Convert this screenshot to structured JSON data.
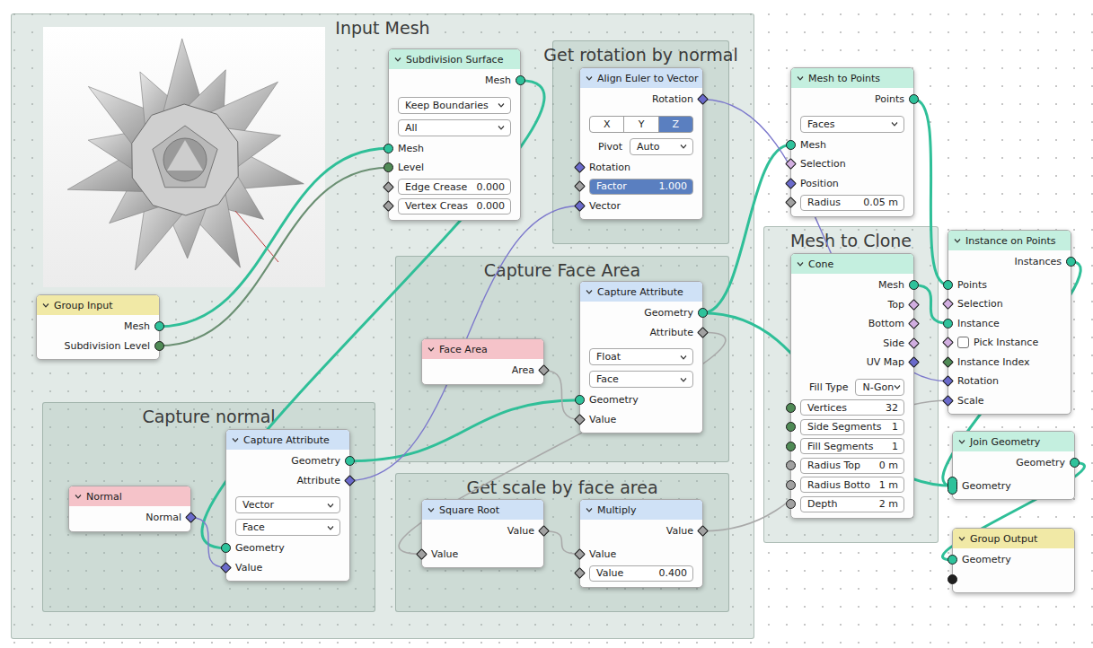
{
  "frames": [
    {
      "label": "Input Mesh"
    },
    {
      "label": "Get rotation by normal"
    },
    {
      "label": "Capture Face Area"
    },
    {
      "label": "Capture normal"
    },
    {
      "label": "Get scale by face area"
    },
    {
      "label": "Mesh to Clone"
    }
  ],
  "nodes": [
    {
      "title": "Group Input",
      "color": "#f1e9a6",
      "expanded": true,
      "rows": [
        {
          "kind": "output",
          "label": "Mesh",
          "socket": "geometry",
          "shape": "circle"
        },
        {
          "kind": "output",
          "label": "Subdivision Level",
          "socket": "int",
          "shape": "circle"
        }
      ]
    },
    {
      "title": "Subdivision Surface",
      "color": "#c4efdf",
      "expanded": true,
      "rows": [
        {
          "kind": "output",
          "label": "Mesh",
          "socket": "geometry",
          "shape": "circle"
        },
        {
          "kind": "dropdown",
          "value": "Keep Boundaries"
        },
        {
          "kind": "dropdown",
          "value": "All"
        },
        {
          "kind": "input",
          "label": "Mesh",
          "socket": "geometry",
          "shape": "circle"
        },
        {
          "kind": "input",
          "label": "Level",
          "socket": "int",
          "shape": "circle"
        },
        {
          "kind": "field",
          "label": "Edge Crease",
          "value": "0.000",
          "socket": "float",
          "shape": "diamond"
        },
        {
          "kind": "field",
          "label": "Vertex Creas",
          "value": "0.000",
          "socket": "float",
          "shape": "diamond"
        }
      ]
    },
    {
      "title": "Capture Attribute",
      "color": "#cfe1f6",
      "expanded": true,
      "rows": [
        {
          "kind": "output",
          "label": "Geometry",
          "socket": "geometry",
          "shape": "circle"
        },
        {
          "kind": "output",
          "label": "Attribute",
          "socket": "vector",
          "shape": "diamond"
        },
        {
          "kind": "dropdown",
          "value": "Vector"
        },
        {
          "kind": "dropdown",
          "value": "Face"
        },
        {
          "kind": "input",
          "label": "Geometry",
          "socket": "geometry",
          "shape": "circle"
        },
        {
          "kind": "input",
          "label": "Value",
          "socket": "vector",
          "shape": "diamond"
        }
      ]
    },
    {
      "title": "Normal",
      "color": "#f5c3c9",
      "expanded": true,
      "rows": [
        {
          "kind": "output",
          "label": "Normal",
          "socket": "vector",
          "shape": "diamond"
        }
      ]
    },
    {
      "title": "Align Euler to Vector",
      "color": "#cfe1f6",
      "expanded": true,
      "rows": [
        {
          "kind": "output",
          "label": "Rotation",
          "socket": "vector",
          "shape": "diamond"
        },
        {
          "kind": "buttons",
          "options": [
            {
              "label": "X",
              "selected": false
            },
            {
              "label": "Y",
              "selected": false
            },
            {
              "label": "Z",
              "selected": true
            }
          ]
        },
        {
          "kind": "labeled-dropdown",
          "label": "Pivot",
          "value": "Auto"
        },
        {
          "kind": "input",
          "label": "Rotation",
          "socket": "vector",
          "shape": "diamond"
        },
        {
          "kind": "slider",
          "label": "Factor",
          "value": "1.000",
          "level": 1,
          "socket": "float",
          "shape": "diamond"
        },
        {
          "kind": "input",
          "label": "Vector",
          "socket": "vector",
          "shape": "diamond"
        }
      ]
    },
    {
      "title": "Face Area",
      "color": "#f5c3c9",
      "expanded": true,
      "rows": [
        {
          "kind": "output",
          "label": "Area",
          "socket": "float",
          "shape": "diamond"
        }
      ]
    },
    {
      "title": "Capture Attribute",
      "color": "#cfe1f6",
      "expanded": true,
      "rows": [
        {
          "kind": "output",
          "label": "Geometry",
          "socket": "geometry",
          "shape": "circle"
        },
        {
          "kind": "output",
          "label": "Attribute",
          "socket": "float",
          "shape": "diamond"
        },
        {
          "kind": "dropdown",
          "value": "Float"
        },
        {
          "kind": "dropdown",
          "value": "Face"
        },
        {
          "kind": "input",
          "label": "Geometry",
          "socket": "geometry",
          "shape": "circle"
        },
        {
          "kind": "input",
          "label": "Value",
          "socket": "float",
          "shape": "diamond"
        }
      ]
    },
    {
      "title": "Square Root",
      "color": "#cfe1f6",
      "expanded": true,
      "rows": [
        {
          "kind": "output",
          "label": "Value",
          "socket": "float",
          "shape": "diamond"
        },
        {
          "kind": "input",
          "label": "Value",
          "socket": "float",
          "shape": "diamond"
        }
      ]
    },
    {
      "title": "Multiply",
      "color": "#cfe1f6",
      "expanded": true,
      "rows": [
        {
          "kind": "output",
          "label": "Value",
          "socket": "float",
          "shape": "diamond"
        },
        {
          "kind": "input",
          "label": "Value",
          "socket": "float",
          "shape": "diamond"
        },
        {
          "kind": "field",
          "label": "Value",
          "value": "0.400",
          "socket": "float",
          "shape": "diamond"
        }
      ]
    },
    {
      "title": "Mesh to Points",
      "color": "#c4efdf",
      "expanded": true,
      "rows": [
        {
          "kind": "output",
          "label": "Points",
          "socket": "geometry",
          "shape": "circle"
        },
        {
          "kind": "dropdown",
          "value": "Faces"
        },
        {
          "kind": "input",
          "label": "Mesh",
          "socket": "geometry",
          "shape": "circle"
        },
        {
          "kind": "input",
          "label": "Selection",
          "socket": "bool",
          "shape": "diamond"
        },
        {
          "kind": "input",
          "label": "Position",
          "socket": "vector",
          "shape": "diamond"
        },
        {
          "kind": "field",
          "label": "Radius",
          "value": "0.05 m",
          "socket": "float",
          "shape": "diamond"
        }
      ]
    },
    {
      "title": "Cone",
      "color": "#c4efdf",
      "expanded": true,
      "rows": [
        {
          "kind": "output",
          "label": "Mesh",
          "socket": "geometry",
          "shape": "circle"
        },
        {
          "kind": "output",
          "label": "Top",
          "socket": "bool",
          "shape": "diamond"
        },
        {
          "kind": "output",
          "label": "Bottom",
          "socket": "bool",
          "shape": "diamond"
        },
        {
          "kind": "output",
          "label": "Side",
          "socket": "bool",
          "shape": "diamond"
        },
        {
          "kind": "output",
          "label": "UV Map",
          "socket": "vector",
          "shape": "diamond"
        },
        {
          "kind": "labeled-dropdown",
          "label": "Fill Type",
          "value": "N-Gon"
        },
        {
          "kind": "field",
          "label": "Vertices",
          "value": "32",
          "socket": "int",
          "shape": "circle"
        },
        {
          "kind": "field",
          "label": "Side Segments",
          "value": "1",
          "socket": "int",
          "shape": "circle"
        },
        {
          "kind": "field",
          "label": "Fill Segments",
          "value": "1",
          "socket": "int",
          "shape": "circle"
        },
        {
          "kind": "field",
          "label": "Radius Top",
          "value": "0 m",
          "socket": "float",
          "shape": "circle"
        },
        {
          "kind": "field",
          "label": "Radius Botto",
          "value": "1 m",
          "socket": "float",
          "shape": "circle"
        },
        {
          "kind": "field",
          "label": "Depth",
          "value": "2 m",
          "socket": "float",
          "shape": "circle"
        }
      ]
    },
    {
      "title": "Instance on Points",
      "color": "#c4efdf",
      "expanded": true,
      "rows": [
        {
          "kind": "output",
          "label": "Instances",
          "socket": "geometry",
          "shape": "circle"
        },
        {
          "kind": "input",
          "label": "Points",
          "socket": "geometry",
          "shape": "circle"
        },
        {
          "kind": "input",
          "label": "Selection",
          "socket": "bool",
          "shape": "diamond"
        },
        {
          "kind": "input",
          "label": "Instance",
          "socket": "geometry",
          "shape": "circle"
        },
        {
          "kind": "checkbox",
          "label": "Pick Instance",
          "checked": false,
          "socket": "bool",
          "shape": "diamond"
        },
        {
          "kind": "input",
          "label": "Instance Index",
          "socket": "int",
          "shape": "diamond"
        },
        {
          "kind": "input",
          "label": "Rotation",
          "socket": "vector",
          "shape": "diamond"
        },
        {
          "kind": "input",
          "label": "Scale",
          "socket": "vector",
          "shape": "diamond"
        }
      ]
    },
    {
      "title": "Join Geometry",
      "color": "#c4efdf",
      "expanded": true,
      "rows": [
        {
          "kind": "output",
          "label": "Geometry",
          "socket": "geometry",
          "shape": "circle"
        },
        {
          "kind": "input",
          "label": "Geometry",
          "socket": "geometry",
          "shape": "multi"
        }
      ]
    },
    {
      "title": "Group Output",
      "color": "#f1e9a6",
      "expanded": true,
      "rows": [
        {
          "kind": "input",
          "label": "Geometry",
          "socket": "geometry",
          "shape": "circle"
        },
        {
          "kind": "socket-only",
          "socket": "none",
          "shape": "circle"
        }
      ]
    }
  ],
  "links": [
    {
      "from": [
        0,
        0
      ],
      "to": [
        1,
        3
      ]
    },
    {
      "from": [
        0,
        1
      ],
      "to": [
        1,
        4
      ]
    },
    {
      "from": [
        1,
        0
      ],
      "to": [
        2,
        4
      ]
    },
    {
      "from": [
        3,
        0
      ],
      "to": [
        2,
        5
      ]
    },
    {
      "from": [
        2,
        0
      ],
      "to": [
        6,
        4
      ]
    },
    {
      "from": [
        2,
        1
      ],
      "to": [
        4,
        5
      ]
    },
    {
      "from": [
        5,
        0
      ],
      "to": [
        6,
        5
      ]
    },
    {
      "from": [
        6,
        0
      ],
      "to": [
        9,
        2
      ]
    },
    {
      "from": [
        6,
        1
      ],
      "to": [
        7,
        1
      ]
    },
    {
      "from": [
        7,
        0
      ],
      "to": [
        8,
        1
      ]
    },
    {
      "from": [
        8,
        0
      ],
      "to": [
        11,
        7
      ]
    },
    {
      "from": [
        4,
        0
      ],
      "to": [
        11,
        6
      ]
    },
    {
      "from": [
        9,
        0
      ],
      "to": [
        11,
        1
      ]
    },
    {
      "from": [
        10,
        0
      ],
      "to": [
        11,
        3
      ]
    },
    {
      "from": [
        11,
        0
      ],
      "to": [
        12,
        1
      ]
    },
    {
      "from": [
        6,
        0
      ],
      "to": [
        12,
        1
      ]
    },
    {
      "from": [
        12,
        0
      ],
      "to": [
        13,
        0
      ]
    }
  ]
}
